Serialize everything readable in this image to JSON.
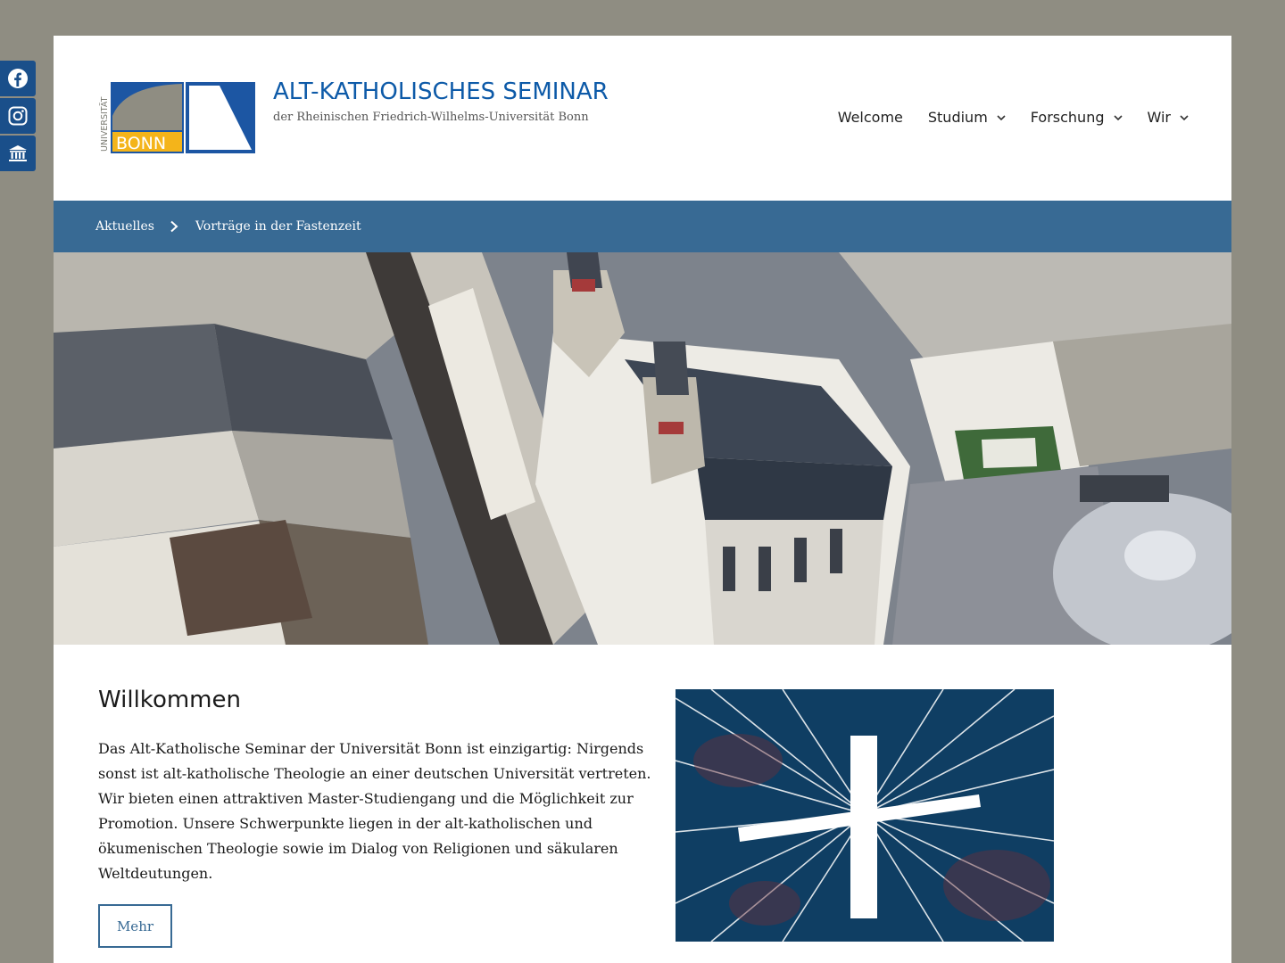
{
  "social": [
    {
      "name": "facebook",
      "icon": "facebook-icon"
    },
    {
      "name": "instagram",
      "icon": "instagram-icon"
    },
    {
      "name": "university",
      "icon": "university-icon"
    }
  ],
  "logo": {
    "vertical_text": "UNIVERSITÄT",
    "word": "BONN"
  },
  "site": {
    "title": "ALT-KATHOLISCHES SEMINAR",
    "description": "der Rheinischen Friedrich-Wilhelms-Universität Bonn"
  },
  "nav": {
    "items": [
      {
        "label": "Welcome",
        "has_submenu": false
      },
      {
        "label": "Studium",
        "has_submenu": true
      },
      {
        "label": "Forschung",
        "has_submenu": true
      },
      {
        "label": "Wir",
        "has_submenu": true
      }
    ]
  },
  "subnav": {
    "first": "Aktuelles",
    "second": "Vorträge in der Fastenzeit"
  },
  "content": {
    "heading": "Willkommen",
    "body": "Das Alt-Katholische Seminar der Universität Bonn ist einzigartig: Nirgends sonst ist alt-katholische Theologie an einer deutschen Universität vertreten. Wir bieten einen attraktiven Master-Studiengang und die Möglichkeit zur Promotion. Unsere Schwerpunkte liegen in der alt-katholischen und ökumenischen Theologie sowie im Dialog von Religionen und säkularen Weltdeutungen.",
    "more_label": "Mehr"
  },
  "colors": {
    "accent": "#386a94",
    "title": "#0d5aa8",
    "page_bg": "#8f8d82",
    "social_bg": "#1a4f8a"
  }
}
